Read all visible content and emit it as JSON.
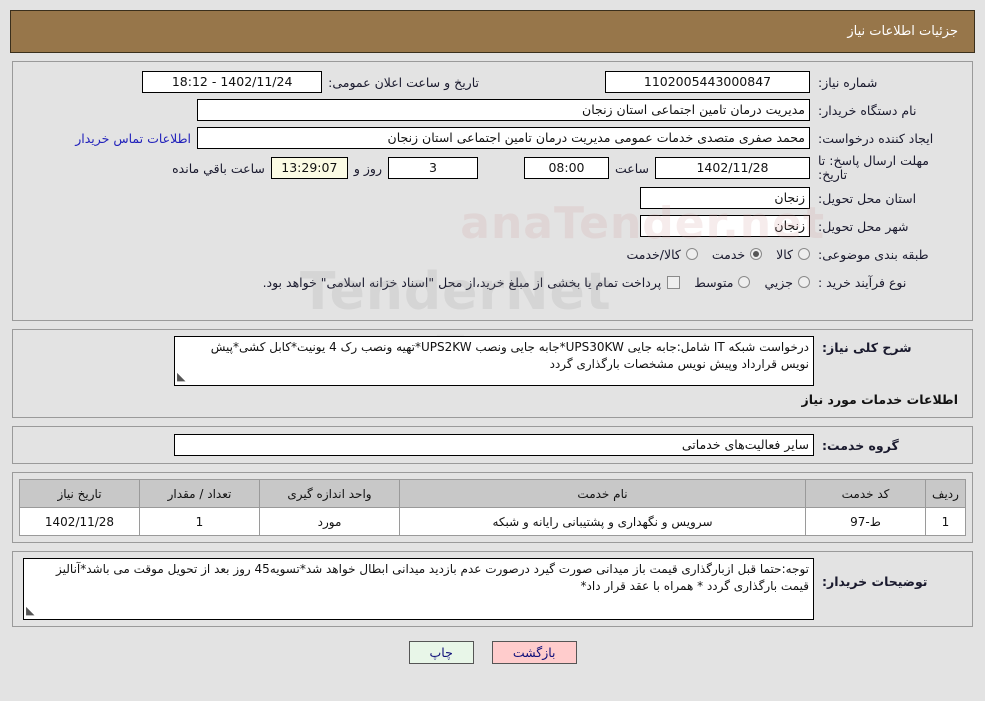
{
  "header": {
    "title": "جزئیات اطلاعات نیاز"
  },
  "watermark": {
    "text1": "TenderNet",
    "text2": "anaTender.net",
    "text3": "aT"
  },
  "form": {
    "need_number_label": "شماره نیاز:",
    "need_number_value": "1102005443000847",
    "public_announce_label": "تاریخ و ساعت اعلان عمومی:",
    "public_announce_value": "1402/11/24 - 18:12",
    "buyer_org_label": "نام دستگاه خریدار:",
    "buyer_org_value": "مدیریت درمان تامین اجتماعی استان زنجان",
    "creator_label": "ایجاد کننده درخواست:",
    "creator_value": "محمد صفری متصدی خدمات عمومی مدیریت درمان تامین اجتماعی استان زنجان",
    "contact_link": "اطلاعات تماس خریدار",
    "deadline_label": "مهلت ارسال پاسخ: تا تاریخ:",
    "deadline_date": "1402/11/28",
    "deadline_hour_label": "ساعت",
    "deadline_hour_value": "08:00",
    "remaining_days_value": "3",
    "remaining_days_label": "روز و",
    "remaining_time_value": "13:29:07",
    "remaining_suffix_label": "ساعت باقي مانده",
    "province_label": "استان محل تحویل:",
    "province_value": "زنجان",
    "city_label": "شهر محل تحویل:",
    "city_value": "زنجان",
    "category_label": "طبقه بندی موضوعی:",
    "category_options": [
      {
        "label": "کالا",
        "selected": false
      },
      {
        "label": "خدمت",
        "selected": true
      },
      {
        "label": "کالا/خدمت",
        "selected": false
      }
    ],
    "process_label": "نوع فرآیند خرید :",
    "process_options": [
      {
        "label": "جزیي",
        "selected": false
      },
      {
        "label": "متوسط",
        "selected": false
      }
    ],
    "treasury_checkbox_label": "پرداخت تمام یا بخشی از مبلغ خرید،از محل \"اسناد خزانه اسلامی\" خواهد بود.",
    "treasury_checked": false
  },
  "description": {
    "label": "شرح کلی نیاز:",
    "value": "درخواست شبکه IT شامل:جابه جایی UPS30KW*جابه جایی ونصب UPS2KW*تهیه ونصب رک 4 یونیت*کابل کشی*پیش نویس قرارداد وپیش نویس  مشخصات بارگذاری گردد"
  },
  "services_section": {
    "heading": "اطلاعات خدمات مورد نیاز",
    "group_label": "گروه خدمت:",
    "group_value": "سایر فعالیت‌های خدماتی"
  },
  "table": {
    "headers": [
      "ردیف",
      "کد خدمت",
      "نام خدمت",
      "واحد اندازه گیری",
      "تعداد / مقدار",
      "تاریخ نیاز"
    ],
    "rows": [
      {
        "index": "1",
        "code": "ط-97",
        "name": "سرویس و نگهداری و پشتیبانی رایانه و شبکه",
        "unit": "مورد",
        "qty": "1",
        "date": "1402/11/28"
      }
    ]
  },
  "buyer_notes": {
    "label": "توضیحات خریدار:",
    "value": "توجه:حتما قبل ازبارگذاری قیمت باز میدانی صورت گیرد درصورت عدم بازدید میدانی  ابطال خواهد شد*تسویه45 روز بعد از تحویل موقت می باشد*آنالیز قیمت بارگذاری گردد * همراه با عقد قرار داد*"
  },
  "footer": {
    "back_label": "بازگشت",
    "print_label": "چاپ"
  },
  "colors": {
    "header_bg": "#97764a",
    "back_btn_bg": "#ffcccc",
    "print_btn_bg": "#e8f6e8",
    "link": "#2222bb",
    "countdown_bg": "#fbfbe4"
  }
}
